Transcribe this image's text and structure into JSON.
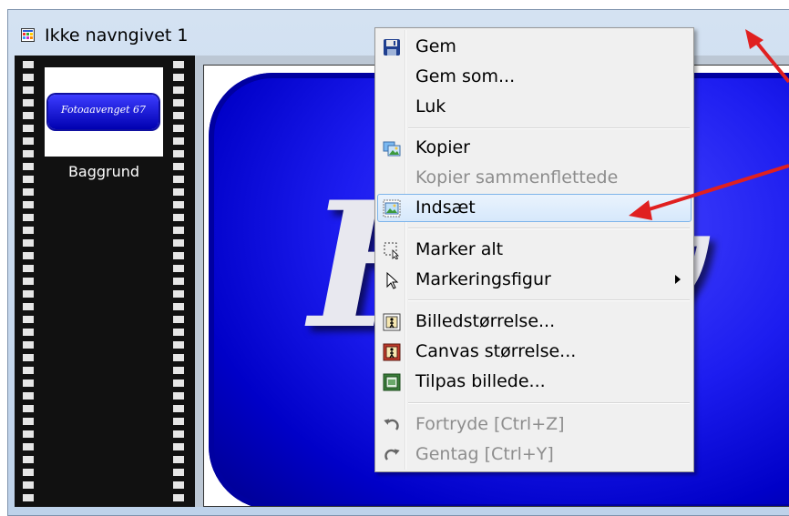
{
  "window": {
    "title": "Ikke navngivet 1"
  },
  "layers": [
    {
      "thumbnail_text": "Fotoaavenget 67",
      "label": "Baggrund"
    }
  ],
  "canvas": {
    "text": "Fotoaavenget 67",
    "visible_text": "Fow"
  },
  "context_menu": {
    "items": [
      {
        "label": "Gem",
        "icon": "save-icon",
        "enabled": true
      },
      {
        "label": "Gem som...",
        "icon": "",
        "enabled": true
      },
      {
        "label": "Luk",
        "icon": "",
        "enabled": true
      },
      {
        "label": "Kopier",
        "icon": "copy-image-icon",
        "enabled": true
      },
      {
        "label": "Kopier sammenflettede",
        "icon": "",
        "enabled": false
      },
      {
        "label": "Indsæt",
        "icon": "paste-image-icon",
        "enabled": true,
        "highlighted": true
      },
      {
        "label": "Marker alt",
        "icon": "select-all-icon",
        "enabled": true
      },
      {
        "label": "Markeringsfigur",
        "icon": "cursor-arrow-icon",
        "enabled": true,
        "has_submenu": true
      },
      {
        "label": "Billedstørrelse...",
        "icon": "image-size-icon",
        "enabled": true
      },
      {
        "label": "Canvas størrelse...",
        "icon": "canvas-size-icon",
        "enabled": true
      },
      {
        "label": "Tilpas billede...",
        "icon": "fit-image-icon",
        "enabled": true
      },
      {
        "label": "Fortryde [Ctrl+Z]",
        "icon": "undo-icon",
        "enabled": false
      },
      {
        "label": "Gentag [Ctrl+Y]",
        "icon": "redo-icon",
        "enabled": false
      }
    ]
  },
  "colors": {
    "accent_arrow": "#e02020",
    "highlight_border": "#7eb4ea",
    "button_blue": "#0000c8"
  }
}
